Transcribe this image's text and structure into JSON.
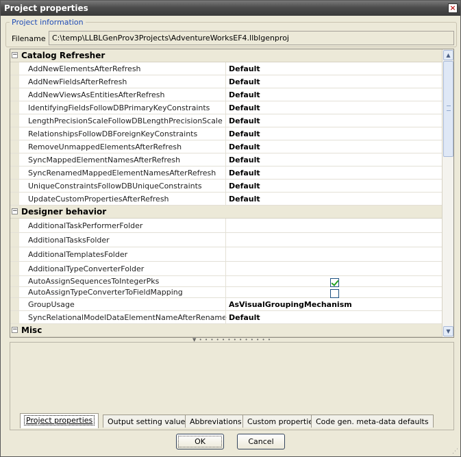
{
  "window": {
    "title": "Project properties",
    "close_glyph": "×"
  },
  "project_info": {
    "legend": "Project information",
    "filename_label": "Filename",
    "filename_value": "C:\\temp\\LLBLGenProv3Projects\\AdventureWorksEF4.llblgenproj"
  },
  "categories": [
    {
      "label": "Catalog Refresher",
      "toggle": "−",
      "properties": [
        {
          "name": "AddNewElementsAfterRefresh",
          "value": "Default"
        },
        {
          "name": "AddNewFieldsAfterRefresh",
          "value": "Default"
        },
        {
          "name": "AddNewViewsAsEntitiesAfterRefresh",
          "value": "Default"
        },
        {
          "name": "IdentifyingFieldsFollowDBPrimaryKeyConstraints",
          "value": "Default"
        },
        {
          "name": "LengthPrecisionScaleFollowDBLengthPrecisionScale",
          "value": "Default"
        },
        {
          "name": "RelationshipsFollowDBForeignKeyConstraints",
          "value": "Default"
        },
        {
          "name": "RemoveUnmappedElementsAfterRefresh",
          "value": "Default"
        },
        {
          "name": "SyncMappedElementNamesAfterRefresh",
          "value": "Default"
        },
        {
          "name": "SyncRenamedMappedElementNamesAfterRefresh",
          "value": "Default"
        },
        {
          "name": "UniqueConstraintsFollowDBUniqueConstraints",
          "value": "Default"
        },
        {
          "name": "UpdateCustomPropertiesAfterRefresh",
          "value": "Default"
        }
      ]
    },
    {
      "label": "Designer behavior",
      "toggle": "−",
      "properties": [
        {
          "name": "AdditionalTaskPerformerFolder",
          "value": ""
        },
        {
          "name": "AdditionalTasksFolder",
          "value": ""
        },
        {
          "name": "AdditionalTemplatesFolder",
          "value": ""
        },
        {
          "name": "AdditionalTypeConverterFolder",
          "value": ""
        },
        {
          "name": "AutoAssignSequencesToIntegerPks",
          "checkbox": true,
          "checked": true
        },
        {
          "name": "AutoAssignTypeConverterToFieldMapping",
          "checkbox": true,
          "checked": false
        },
        {
          "name": "GroupUsage",
          "value": "AsVisualGroupingMechanism"
        },
        {
          "name": "SyncRelationalModelDataElementNameAfterRename",
          "value": "Default"
        }
      ]
    },
    {
      "label": "Misc",
      "toggle": "−",
      "properties": []
    }
  ],
  "tabs": [
    {
      "label": "Project properties",
      "active": true
    },
    {
      "label": "Output setting values",
      "active": false
    },
    {
      "label": "Abbreviations",
      "active": false
    },
    {
      "label": "Custom properties",
      "active": false
    },
    {
      "label": "Code gen. meta-data defaults",
      "active": false
    }
  ],
  "buttons": {
    "ok": "OK",
    "cancel": "Cancel"
  }
}
